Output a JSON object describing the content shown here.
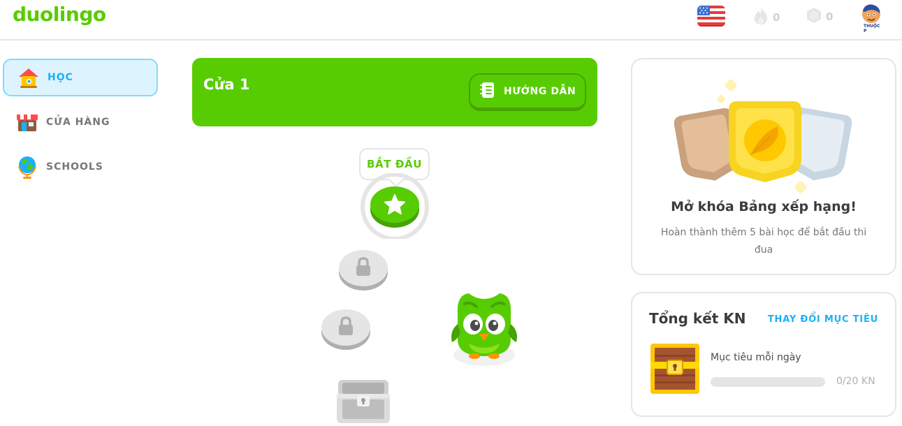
{
  "brand": {
    "logo_text": "duolingo",
    "color": "#58cc02"
  },
  "topbar": {
    "course_flag": "us-flag-icon",
    "streak": {
      "icon": "flame-icon",
      "value": "0"
    },
    "gems": {
      "icon": "gem-icon",
      "value": "0"
    },
    "avatar_text": "THUỘC P"
  },
  "sidebar": {
    "items": [
      {
        "label": "HỌC",
        "icon": "house-icon",
        "active": true
      },
      {
        "label": "CỬA HÀNG",
        "icon": "shop-icon",
        "active": false
      },
      {
        "label": "SCHOOLS",
        "icon": "globe-icon",
        "active": false
      }
    ]
  },
  "unit": {
    "title": "Cửa 1",
    "guide_label": "HƯỚNG DẪN"
  },
  "path": {
    "start_label": "BẮT ĐẦU",
    "nodes": [
      {
        "state": "active",
        "icon": "star-icon"
      },
      {
        "state": "locked",
        "icon": "lock-icon"
      },
      {
        "state": "locked",
        "icon": "lock-icon"
      },
      {
        "state": "locked",
        "icon": "chest-icon"
      }
    ]
  },
  "league_card": {
    "title": "Mở khóa Bảng xếp hạng!",
    "description": "Hoàn thành thêm 5 bài học để bắt đầu thi đua"
  },
  "xp_card": {
    "title": "Tổng kết KN",
    "action": "THAY ĐỔI MỤC TIÊU",
    "goal_label": "Mục tiêu mỗi ngày",
    "goal_value": "0/20 KN",
    "progress": 0
  },
  "colors": {
    "primary_green": "#58cc02",
    "accent_blue": "#1cb0f6",
    "active_nav_bg": "#ddf4ff",
    "border_gray": "#e5e5e5"
  }
}
